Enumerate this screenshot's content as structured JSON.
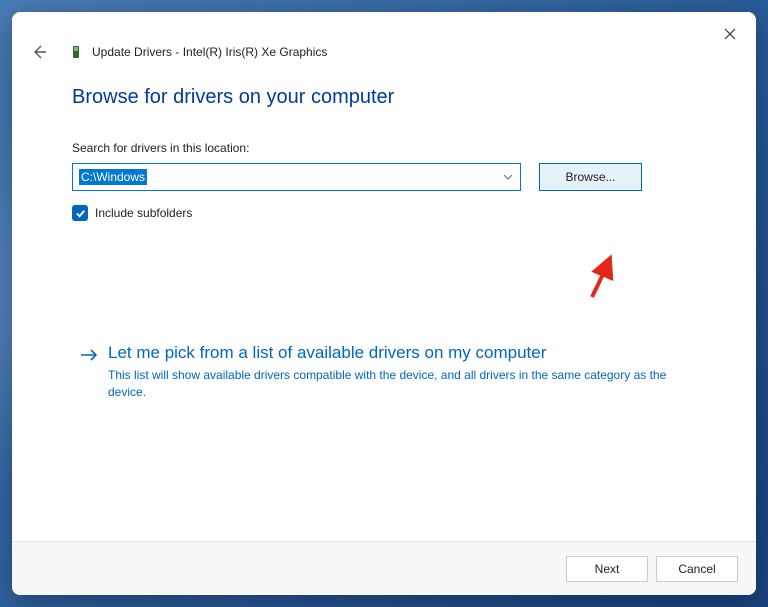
{
  "window": {
    "title": "Update Drivers - Intel(R) Iris(R) Xe Graphics"
  },
  "page": {
    "heading": "Browse for drivers on your computer",
    "search_label": "Search for drivers in this location:",
    "path_value": "C:\\Windows",
    "browse_label": "Browse...",
    "include_subfolders_label": "Include subfolders",
    "include_subfolders_checked": true,
    "option": {
      "title": "Let me pick from a list of available drivers on my computer",
      "description": "This list will show available drivers compatible with the device, and all drivers in the same category as the device."
    }
  },
  "footer": {
    "next_label": "Next",
    "cancel_label": "Cancel"
  }
}
